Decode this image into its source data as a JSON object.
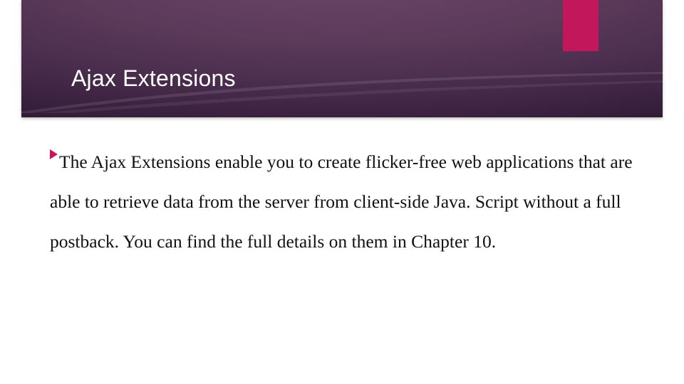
{
  "colors": {
    "accent": "#c2185b",
    "title_text": "#ffffff",
    "body_text": "#111111"
  },
  "slide": {
    "title": "Ajax Extensions",
    "bullets": [
      {
        "text": "The Ajax Extensions enable you to create flicker-free web applications that are able to retrieve data from the server from client-side Java. Script without a full postback. You can find the full details on them in Chapter 10."
      }
    ]
  }
}
